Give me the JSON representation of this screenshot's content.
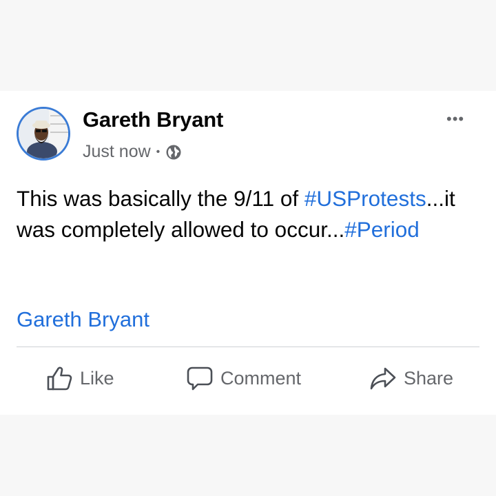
{
  "post": {
    "author": "Gareth Bryant",
    "timestamp": "Just now",
    "separator": "•",
    "privacy_icon": "globe-icon",
    "more_label": "•••",
    "text": [
      {
        "t": "This was basically the 9/11 of ",
        "hashtag": false
      },
      {
        "t": "#USProtests",
        "hashtag": true
      },
      {
        "t": "...it was completely allowed to occur...",
        "hashtag": false
      },
      {
        "t": "#Period",
        "hashtag": true
      }
    ],
    "source_name": "Gareth Bryant"
  },
  "actions": {
    "like": "Like",
    "comment": "Comment",
    "share": "Share"
  },
  "colors": {
    "link": "#216fdb",
    "muted": "#65676b",
    "avatar_ring": "#3a7bd5"
  }
}
